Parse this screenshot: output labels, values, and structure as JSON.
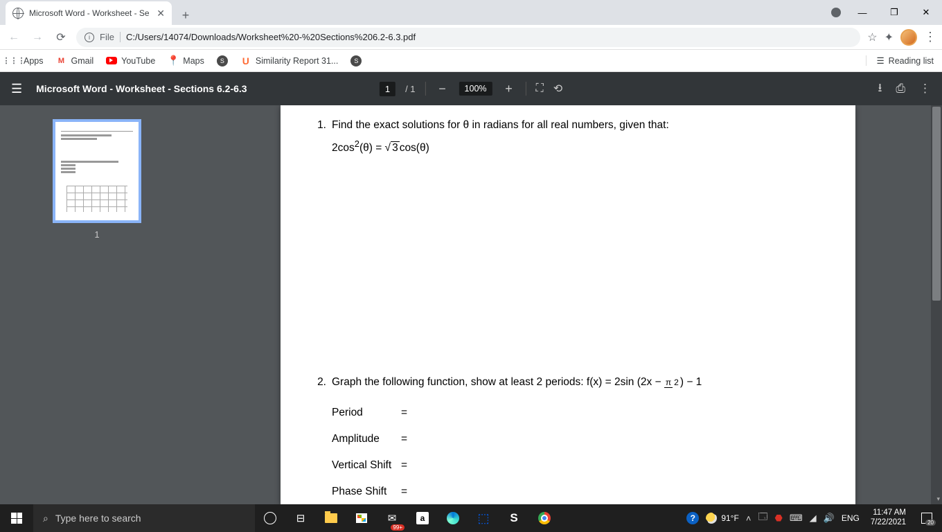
{
  "browser": {
    "tab_title": "Microsoft Word - Worksheet - Se",
    "url_scheme": "File",
    "url_path": "C:/Users/14074/Downloads/Worksheet%20-%20Sections%206.2-6.3.pdf"
  },
  "bookmarks": {
    "apps": "Apps",
    "gmail": "Gmail",
    "youtube": "YouTube",
    "maps": "Maps",
    "similarity": "Similarity Report 31...",
    "reading_list": "Reading list"
  },
  "pdf": {
    "title": "Microsoft Word - Worksheet - Sections 6.2-6.3",
    "page_current": "1",
    "page_sep": "/ 1",
    "zoom": "100%",
    "thumb_number": "1"
  },
  "doc": {
    "q1_num": "1.",
    "q1_text": "Find the exact solutions for θ in radians for all real numbers, given that:",
    "q1_eq_lhs": "2cos",
    "q1_eq_sup": "2",
    "q1_eq_arg1": "(θ) = ",
    "q1_eq_root": "3",
    "q1_eq_tail": "cos(θ)",
    "q2_num": "2.",
    "q2_text_a": "Graph the following function, show at least 2 periods: f(x) = 2sin (2x − ",
    "q2_frac_n": "π",
    "q2_frac_d": "2",
    "q2_text_b": ") − 1",
    "period": "Period",
    "amplitude": "Amplitude",
    "vshift": "Vertical Shift",
    "pshift": "Phase Shift",
    "eq": "="
  },
  "taskbar": {
    "search_placeholder": "Type here to search",
    "mail_badge": "99+",
    "weather": "91°F",
    "lang": "ENG",
    "time": "11:47 AM",
    "date": "7/22/2021",
    "notif_count": "20"
  }
}
